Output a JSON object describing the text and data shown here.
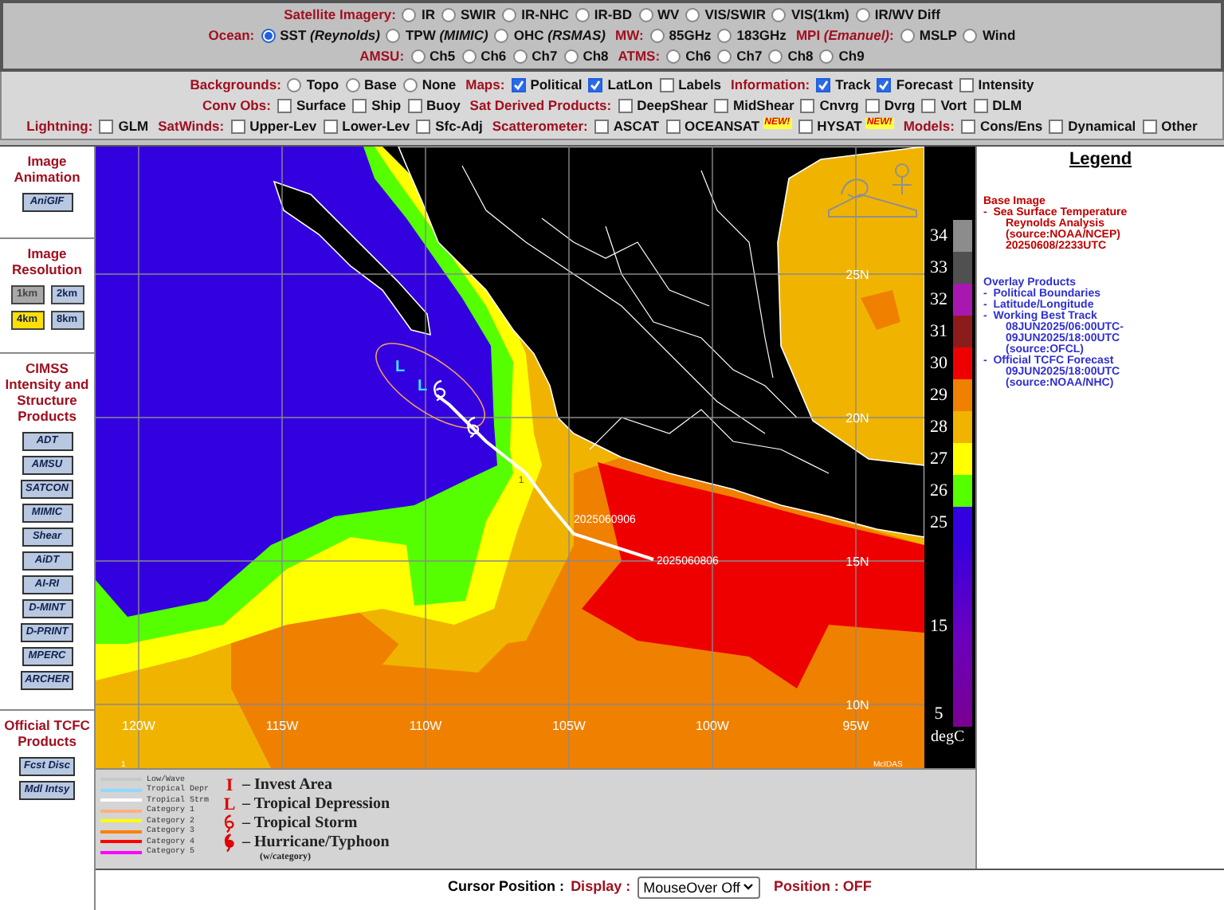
{
  "imagery_rows": [
    {
      "groups": [
        {
          "label": "Satellite Imagery:",
          "options": [
            {
              "label": "IR",
              "selected": false
            },
            {
              "label": "SWIR",
              "selected": false
            },
            {
              "label": "IR-NHC",
              "selected": false
            },
            {
              "label": "IR-BD",
              "selected": false
            },
            {
              "label": "WV",
              "selected": false
            },
            {
              "label": "VIS/SWIR",
              "selected": false
            },
            {
              "label": "VIS(1km)",
              "selected": false
            },
            {
              "label": "IR/WV Diff",
              "selected": false
            }
          ]
        }
      ]
    },
    {
      "groups": [
        {
          "label": "Ocean:",
          "options": [
            {
              "label": "SST *(Reynolds)*",
              "selected": true
            },
            {
              "label": "TPW *(MIMIC)*",
              "selected": false
            },
            {
              "label": "OHC *(RSMAS)*",
              "selected": false
            }
          ]
        },
        {
          "label": "MW:",
          "options": [
            {
              "label": "85GHz",
              "selected": false
            },
            {
              "label": "183GHz",
              "selected": false
            }
          ]
        },
        {
          "label": "MPI *(Emanuel)*:",
          "options": [
            {
              "label": "MSLP",
              "selected": false
            },
            {
              "label": "Wind",
              "selected": false
            }
          ]
        }
      ]
    },
    {
      "groups": [
        {
          "label": "AMSU:",
          "options": [
            {
              "label": "Ch5",
              "selected": false
            },
            {
              "label": "Ch6",
              "selected": false
            },
            {
              "label": "Ch7",
              "selected": false
            },
            {
              "label": "Ch8",
              "selected": false
            }
          ]
        },
        {
          "label": "ATMS:",
          "options": [
            {
              "label": "Ch6",
              "selected": false
            },
            {
              "label": "Ch7",
              "selected": false
            },
            {
              "label": "Ch8",
              "selected": false
            },
            {
              "label": "Ch9",
              "selected": false
            }
          ]
        }
      ]
    }
  ],
  "overlay_rows": [
    {
      "groups": [
        {
          "label": "Backgrounds:",
          "kind": "radio",
          "options": [
            {
              "label": "Topo",
              "selected": false
            },
            {
              "label": "Base",
              "selected": false
            },
            {
              "label": "None",
              "selected": false
            }
          ]
        },
        {
          "label": "Maps:",
          "kind": "checkbox",
          "options": [
            {
              "label": "Political",
              "checked": true
            },
            {
              "label": "LatLon",
              "checked": true
            },
            {
              "label": "Labels",
              "checked": false
            }
          ]
        },
        {
          "label": "Information:",
          "kind": "checkbox",
          "options": [
            {
              "label": "Track",
              "checked": true
            },
            {
              "label": "Forecast",
              "checked": true
            },
            {
              "label": "Intensity",
              "checked": false
            }
          ]
        }
      ]
    },
    {
      "groups": [
        {
          "label": "Conv Obs:",
          "kind": "checkbox",
          "options": [
            {
              "label": "Surface",
              "checked": false
            },
            {
              "label": "Ship",
              "checked": false
            },
            {
              "label": "Buoy",
              "checked": false
            }
          ]
        },
        {
          "label": "Sat Derived Products:",
          "kind": "checkbox",
          "options": [
            {
              "label": "DeepShear",
              "checked": false
            },
            {
              "label": "MidShear",
              "checked": false
            },
            {
              "label": "Cnvrg",
              "checked": false
            },
            {
              "label": "Dvrg",
              "checked": false
            },
            {
              "label": "Vort",
              "checked": false
            },
            {
              "label": "DLM",
              "checked": false
            }
          ]
        }
      ]
    },
    {
      "groups": [
        {
          "label": "Lightning:",
          "kind": "checkbox",
          "options": [
            {
              "label": "GLM",
              "checked": false
            }
          ]
        },
        {
          "label": "SatWinds:",
          "kind": "checkbox",
          "options": [
            {
              "label": "Upper-Lev",
              "checked": false
            },
            {
              "label": "Lower-Lev",
              "checked": false
            },
            {
              "label": "Sfc-Adj",
              "checked": false
            }
          ]
        },
        {
          "label": "Scatterometer:",
          "kind": "checkbox",
          "options": [
            {
              "label": "ASCAT",
              "checked": false
            },
            {
              "label": "OCEANSAT",
              "checked": false,
              "badge": "NEW!"
            },
            {
              "label": "HYSAT",
              "checked": false,
              "badge": "NEW!"
            }
          ]
        },
        {
          "label": "Models:",
          "kind": "checkbox",
          "options": [
            {
              "label": "Cons/Ens",
              "checked": false
            },
            {
              "label": "Dynamical",
              "checked": false
            },
            {
              "label": "Other",
              "checked": false
            }
          ]
        }
      ]
    }
  ],
  "sidebar": {
    "sections": [
      {
        "title": "Image Animation",
        "kind": "stack",
        "buttons": [
          {
            "label": "AniGIF"
          }
        ]
      },
      {
        "title": "Image Resolution",
        "kind": "grid",
        "buttons": [
          {
            "label": "1km",
            "selected": false,
            "disabled": true
          },
          {
            "label": "2km",
            "selected": false,
            "disabled": false
          },
          {
            "label": "4km",
            "selected": true,
            "disabled": false
          },
          {
            "label": "8km",
            "selected": false,
            "disabled": false
          }
        ]
      },
      {
        "title": "CIMSS Intensity and Structure Products",
        "kind": "stack",
        "buttons": [
          {
            "label": "ADT"
          },
          {
            "label": "AMSU"
          },
          {
            "label": "SATCON"
          },
          {
            "label": "MIMIC"
          },
          {
            "label": "Shear"
          },
          {
            "label": "AiDT"
          },
          {
            "label": "AI-RI"
          },
          {
            "label": "D-MINT"
          },
          {
            "label": "D-PRINT"
          },
          {
            "label": "MPERC"
          },
          {
            "label": "ARCHER"
          }
        ]
      },
      {
        "title": "Official TCFC Products",
        "kind": "stack",
        "buttons": [
          {
            "label": "Fcst Disc"
          },
          {
            "label": "Mdl Intsy"
          }
        ]
      }
    ]
  },
  "map": {
    "lat_labels": [
      "25N",
      "20N",
      "15N",
      "10N"
    ],
    "lon_labels": [
      "120W",
      "115W",
      "110W",
      "105W",
      "100W",
      "95W"
    ],
    "track_labels": [
      "2025060906",
      "2025060806"
    ],
    "track_symbols": [
      "L",
      "L"
    ],
    "invest_label": "1",
    "corner_labels": [
      "1",
      "McIDAS"
    ]
  },
  "colorbar": {
    "steps": [
      {
        "label": "34",
        "color": "#8c8c8c"
      },
      {
        "label": "33",
        "color": "#505050"
      },
      {
        "label": "32",
        "color": "#a818b0"
      },
      {
        "label": "31",
        "color": "#8c1c1c"
      },
      {
        "label": "30",
        "color": "#ee0000"
      },
      {
        "label": "29",
        "color": "#f08000"
      },
      {
        "label": "28",
        "color": "#f0b400"
      },
      {
        "label": "27",
        "color": "#ffff00"
      },
      {
        "label": "26",
        "color": "#55ff00"
      },
      {
        "label": "25",
        "color": "#3300e0"
      }
    ],
    "lower_labels": [
      "15",
      "5"
    ],
    "unit": "degC"
  },
  "legend": {
    "title": "Legend",
    "sections": [
      {
        "title": "Base Image",
        "color": "#c00000",
        "items": [
          {
            "label": "-  Sea Surface Temperature",
            "details": [
              "Reynolds Analysis",
              "(source:NOAA/NCEP)",
              "20250608/2233UTC"
            ]
          }
        ]
      },
      {
        "title": "Overlay Products",
        "color": "#3030d0",
        "items": [
          {
            "label": "-  Political Boundaries"
          },
          {
            "label": "-  Latitude/Longitude"
          },
          {
            "label": "-  Working Best Track",
            "details": [
              "08JUN2025/06:00UTC-",
              "09JUN2025/18:00UTC",
              "(source:OFCL)"
            ]
          },
          {
            "label": "-  Official TCFC Forecast",
            "details": [
              "09JUN2025/18:00UTC",
              "(source:NOAA/NHC)"
            ]
          }
        ]
      }
    ]
  },
  "track_legend": {
    "lines": [
      {
        "label": "Low/Wave",
        "color": "#c8c8c8"
      },
      {
        "label": "Tropical Depr",
        "color": "#8fd8ff"
      },
      {
        "label": "Tropical Strm",
        "color": "#ffffff"
      },
      {
        "label": "Category 1",
        "color": "#ffb080"
      },
      {
        "label": "Category 2",
        "color": "#ffff00"
      },
      {
        "label": "Category 3",
        "color": "#ff8000"
      },
      {
        "label": "Category 4",
        "color": "#ff0000"
      },
      {
        "label": "Category 5",
        "color": "#ff00ff"
      }
    ],
    "symbols": [
      {
        "kind": "text",
        "symbol": "I",
        "label": "– Invest Area"
      },
      {
        "kind": "text",
        "symbol": "L",
        "label": "– Tropical Depression"
      },
      {
        "kind": "storm",
        "label": "– Tropical Storm"
      },
      {
        "kind": "hurricane",
        "label": "– Hurricane/Typhoon",
        "note": "(w/category)"
      }
    ]
  },
  "cursor_bar": {
    "label": "Cursor Position :",
    "display_label": "Display :",
    "display_value": "MouseOver Off",
    "position": "Position : OFF"
  }
}
